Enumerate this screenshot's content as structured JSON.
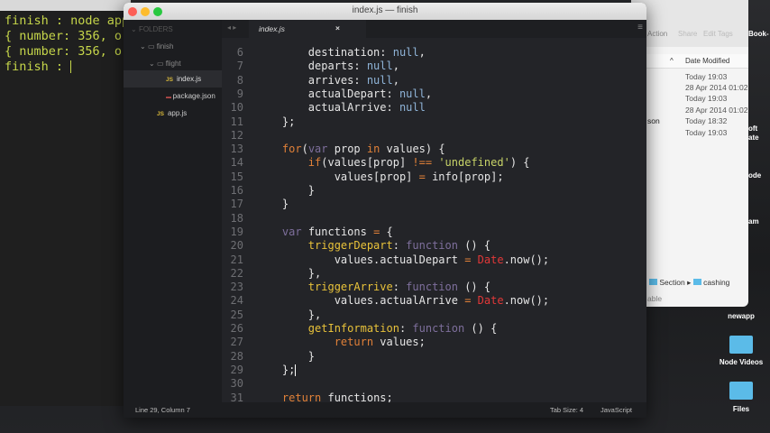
{
  "terminal": {
    "lines": [
      "finish : node app",
      "{ number: 356, or",
      "{ number: 356, or",
      "finish : "
    ]
  },
  "finder": {
    "toolbar": [
      "Action",
      "Share",
      "Edit Tags"
    ],
    "column_header": "Date Modified",
    "name_fragment": "son",
    "dates": [
      "Today 19:03",
      "28 Apr 2014 01:02",
      "Today 19:03",
      "28 Apr 2014 01:02",
      "Today 18:32",
      "Today 19:03"
    ],
    "path": [
      "Section",
      "cashing"
    ],
    "status_fragment": "able"
  },
  "desktop": {
    "items": [
      "newapp",
      "Node Videos",
      "Files"
    ],
    "fragments": [
      "Book-",
      "oft",
      "ate",
      "ode",
      "am"
    ]
  },
  "window": {
    "title": "index.js — finish"
  },
  "sidebar": {
    "header": "FOLDERS",
    "items": [
      {
        "label": "finish",
        "type": "folder"
      },
      {
        "label": "flight",
        "type": "folder"
      },
      {
        "label": "index.js",
        "type": "js",
        "selected": true
      },
      {
        "label": "package.json",
        "type": "json"
      },
      {
        "label": "app.js",
        "type": "js"
      }
    ]
  },
  "tab": {
    "label": "index.js",
    "close": "×"
  },
  "editor": {
    "first_line": 6,
    "lines": [
      [
        [
          "        destination: ",
          ""
        ],
        [
          "null",
          "n"
        ],
        [
          ",",
          ""
        ]
      ],
      [
        [
          "        departs: ",
          ""
        ],
        [
          "null",
          "n"
        ],
        [
          ",",
          ""
        ]
      ],
      [
        [
          "        arrives: ",
          ""
        ],
        [
          "null",
          "n"
        ],
        [
          ",",
          ""
        ]
      ],
      [
        [
          "        actualDepart: ",
          ""
        ],
        [
          "null",
          "n"
        ],
        [
          ",",
          ""
        ]
      ],
      [
        [
          "        actualArrive: ",
          ""
        ],
        [
          "null",
          "n"
        ]
      ],
      [
        [
          "    };",
          ""
        ]
      ],
      [
        [
          "",
          ""
        ]
      ],
      [
        [
          "    ",
          ""
        ],
        [
          "for",
          "k"
        ],
        [
          "(",
          ""
        ],
        [
          "var",
          "f"
        ],
        [
          " prop ",
          ""
        ],
        [
          "in",
          "k"
        ],
        [
          " values) {",
          ""
        ]
      ],
      [
        [
          "        ",
          ""
        ],
        [
          "if",
          "k"
        ],
        [
          "(values[prop] ",
          ""
        ],
        [
          "!==",
          "o"
        ],
        [
          " ",
          ""
        ],
        [
          "'undefined'",
          "s"
        ],
        [
          ") {",
          ""
        ]
      ],
      [
        [
          "            values[prop] ",
          ""
        ],
        [
          "=",
          "o"
        ],
        [
          " info[prop];",
          ""
        ]
      ],
      [
        [
          "        }",
          ""
        ]
      ],
      [
        [
          "    }",
          ""
        ]
      ],
      [
        [
          "",
          ""
        ]
      ],
      [
        [
          "    ",
          ""
        ],
        [
          "var",
          "f"
        ],
        [
          " functions ",
          ""
        ],
        [
          "=",
          "o"
        ],
        [
          " {",
          ""
        ]
      ],
      [
        [
          "        ",
          ""
        ],
        [
          "triggerDepart",
          "m"
        ],
        [
          ": ",
          ""
        ],
        [
          "function",
          "f"
        ],
        [
          " () {",
          ""
        ]
      ],
      [
        [
          "            values.actualDepart ",
          ""
        ],
        [
          "=",
          "o"
        ],
        [
          " ",
          ""
        ],
        [
          "Date",
          "d"
        ],
        [
          ".now();",
          ""
        ]
      ],
      [
        [
          "        },",
          ""
        ]
      ],
      [
        [
          "        ",
          ""
        ],
        [
          "triggerArrive",
          "m"
        ],
        [
          ": ",
          ""
        ],
        [
          "function",
          "f"
        ],
        [
          " () {",
          ""
        ]
      ],
      [
        [
          "            values.actualArrive ",
          ""
        ],
        [
          "=",
          "o"
        ],
        [
          " ",
          ""
        ],
        [
          "Date",
          "d"
        ],
        [
          ".now();",
          ""
        ]
      ],
      [
        [
          "        },",
          ""
        ]
      ],
      [
        [
          "        ",
          ""
        ],
        [
          "getInformation",
          "m"
        ],
        [
          ": ",
          ""
        ],
        [
          "function",
          "f"
        ],
        [
          " () {",
          ""
        ]
      ],
      [
        [
          "            ",
          ""
        ],
        [
          "return",
          "k"
        ],
        [
          " values;",
          ""
        ]
      ],
      [
        [
          "        }",
          ""
        ]
      ],
      [
        [
          "    };",
          ""
        ]
      ],
      [
        [
          "",
          ""
        ]
      ],
      [
        [
          "    ",
          ""
        ],
        [
          "return",
          "k"
        ],
        [
          " functions;",
          ""
        ]
      ]
    ]
  },
  "status": {
    "position": "Line 29, Column 7",
    "tab_size": "Tab Size: 4",
    "syntax": "JavaScript"
  }
}
